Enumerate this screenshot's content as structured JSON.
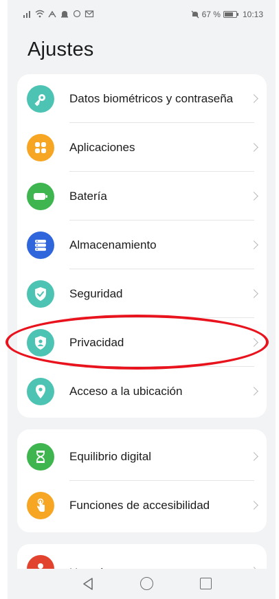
{
  "status_bar": {
    "left_icons": [
      "signal-icon",
      "wifi-icon",
      "network-icon",
      "notification-icon",
      "circle-icon",
      "mail-icon"
    ],
    "battery_percent": "67 %",
    "time": "10:13"
  },
  "page": {
    "title": "Ajustes"
  },
  "groups": [
    {
      "items": [
        {
          "label": "Datos biométricos y contraseña",
          "icon": "key-icon",
          "color": "#4dc3b3"
        },
        {
          "label": "Aplicaciones",
          "icon": "apps-grid-icon",
          "color": "#f6a623"
        },
        {
          "label": "Batería",
          "icon": "battery-icon",
          "color": "#3fb54f"
        },
        {
          "label": "Almacenamiento",
          "icon": "storage-icon",
          "color": "#2f66dc"
        },
        {
          "label": "Seguridad",
          "icon": "shield-check-icon",
          "color": "#4dc3b3"
        },
        {
          "label": "Privacidad",
          "icon": "privacy-shield-icon",
          "color": "#4dc3b3"
        },
        {
          "label": "Acceso a la ubicación",
          "icon": "location-pin-icon",
          "color": "#4dc3b3"
        }
      ]
    },
    {
      "items": [
        {
          "label": "Equilibrio digital",
          "icon": "hourglass-icon",
          "color": "#3fb54f"
        },
        {
          "label": "Funciones de accesibilidad",
          "icon": "hand-touch-icon",
          "color": "#f6a623"
        }
      ]
    },
    {
      "items": [
        {
          "label": "Usuarios y cuentas",
          "icon": "user-icon",
          "color": "#e2432e"
        }
      ]
    }
  ],
  "annotation": {
    "color": "#e8131c",
    "highlighted_item": "Privacidad"
  }
}
